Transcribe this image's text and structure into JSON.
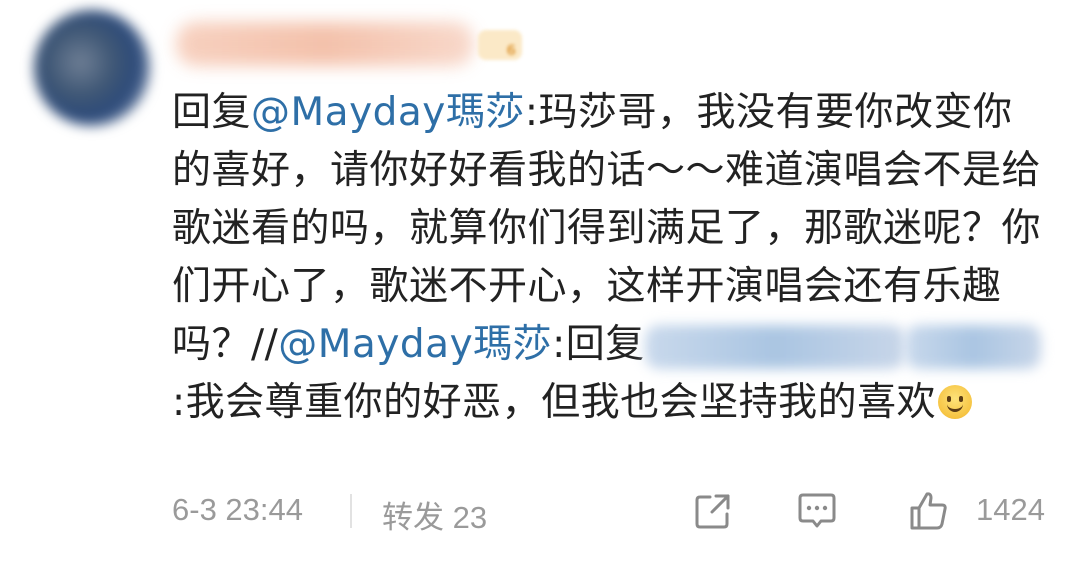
{
  "comment": {
    "reply_prefix": "回复",
    "mention_1": "@Mayday瑪莎",
    "text_1": ":玛莎哥，我没有要你改变你的喜好，请你好好看我的话～～难道演唱会不是给歌迷看的吗，就算你们得到满足了，那歌迷呢？你们开心了，歌迷不开心，这样开演唱会还有乐趣吗？//",
    "mention_2": "@Mayday瑪莎",
    "text_2": ":回复",
    "text_3": ":我会尊重你的好恶，但我也会坚持我的喜欢"
  },
  "footer": {
    "timestamp": "6-3 23:44",
    "forward_label": "转发 23",
    "like_count": "1424"
  },
  "level": "6",
  "icons": {
    "avatar": "avatar",
    "share": "share-icon",
    "comment": "comment-icon",
    "like": "thumbs-up-icon",
    "emoji": "smile-emoji-icon"
  },
  "colors": {
    "mention": "#2e6fa7",
    "text": "#222222",
    "meta": "#9a9a9a"
  }
}
